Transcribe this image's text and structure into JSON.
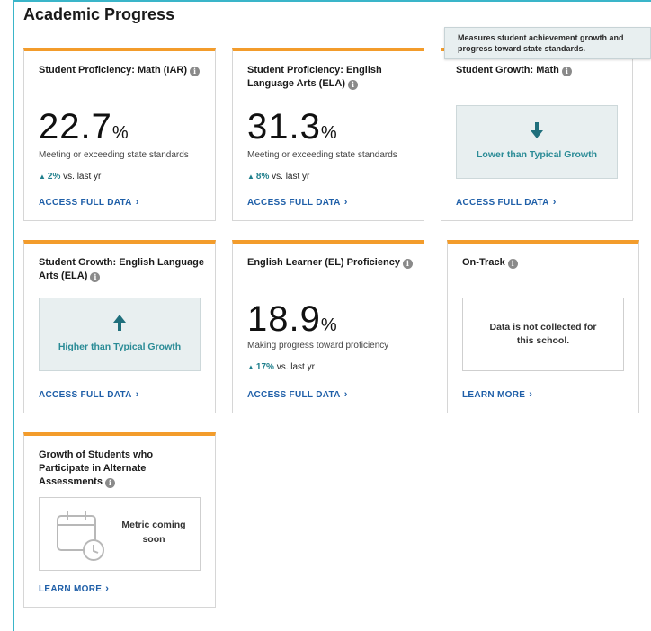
{
  "section": {
    "title": "Academic Progress"
  },
  "tooltip": {
    "text": "Measures student achievement growth and progress toward state standards."
  },
  "cards": {
    "math_prof": {
      "title": "Student Proficiency: Math (IAR)",
      "value": "22.7",
      "unit": "%",
      "desc": "Meeting or exceeding state standards",
      "change_pct": "2%",
      "change_text": "vs. last yr",
      "link": "ACCESS FULL DATA"
    },
    "ela_prof": {
      "title": "Student Proficiency: English Language Arts (ELA)",
      "value": "31.3",
      "unit": "%",
      "desc": "Meeting or exceeding state standards",
      "change_pct": "8%",
      "change_text": "vs. last yr",
      "link": "ACCESS FULL DATA"
    },
    "math_growth": {
      "title": "Student Growth: Math",
      "growth_label": "Lower than Typical Growth",
      "direction": "down",
      "link": "ACCESS FULL DATA"
    },
    "ela_growth": {
      "title": "Student Growth: English Language Arts (ELA)",
      "growth_label": "Higher than Typical Growth",
      "direction": "up",
      "link": "ACCESS FULL DATA"
    },
    "el_prof": {
      "title": "English Learner (EL) Proficiency",
      "value": "18.9",
      "unit": "%",
      "desc": "Making progress toward proficiency",
      "change_pct": "17%",
      "change_text": "vs. last yr",
      "link": "ACCESS FULL DATA"
    },
    "on_track": {
      "title": "On-Track",
      "message": "Data is not collected for this school.",
      "link": "LEARN MORE"
    },
    "alt_assess": {
      "title": "Growth of Students who Participate in Alternate Assessments",
      "message": "Metric coming soon",
      "link": "LEARN MORE"
    }
  },
  "icons": {
    "info": "info-icon",
    "up_arrow": "arrow-up-icon",
    "down_arrow": "arrow-down-icon",
    "chevron": "chevron-right-icon",
    "calendar": "calendar-clock-icon"
  },
  "colors": {
    "card_accent": "#f39c2b",
    "frame_border": "#3ab5c9",
    "link": "#1f5fa8",
    "growth_text": "#2a8b96",
    "positive_change": "#1f7f8c"
  }
}
